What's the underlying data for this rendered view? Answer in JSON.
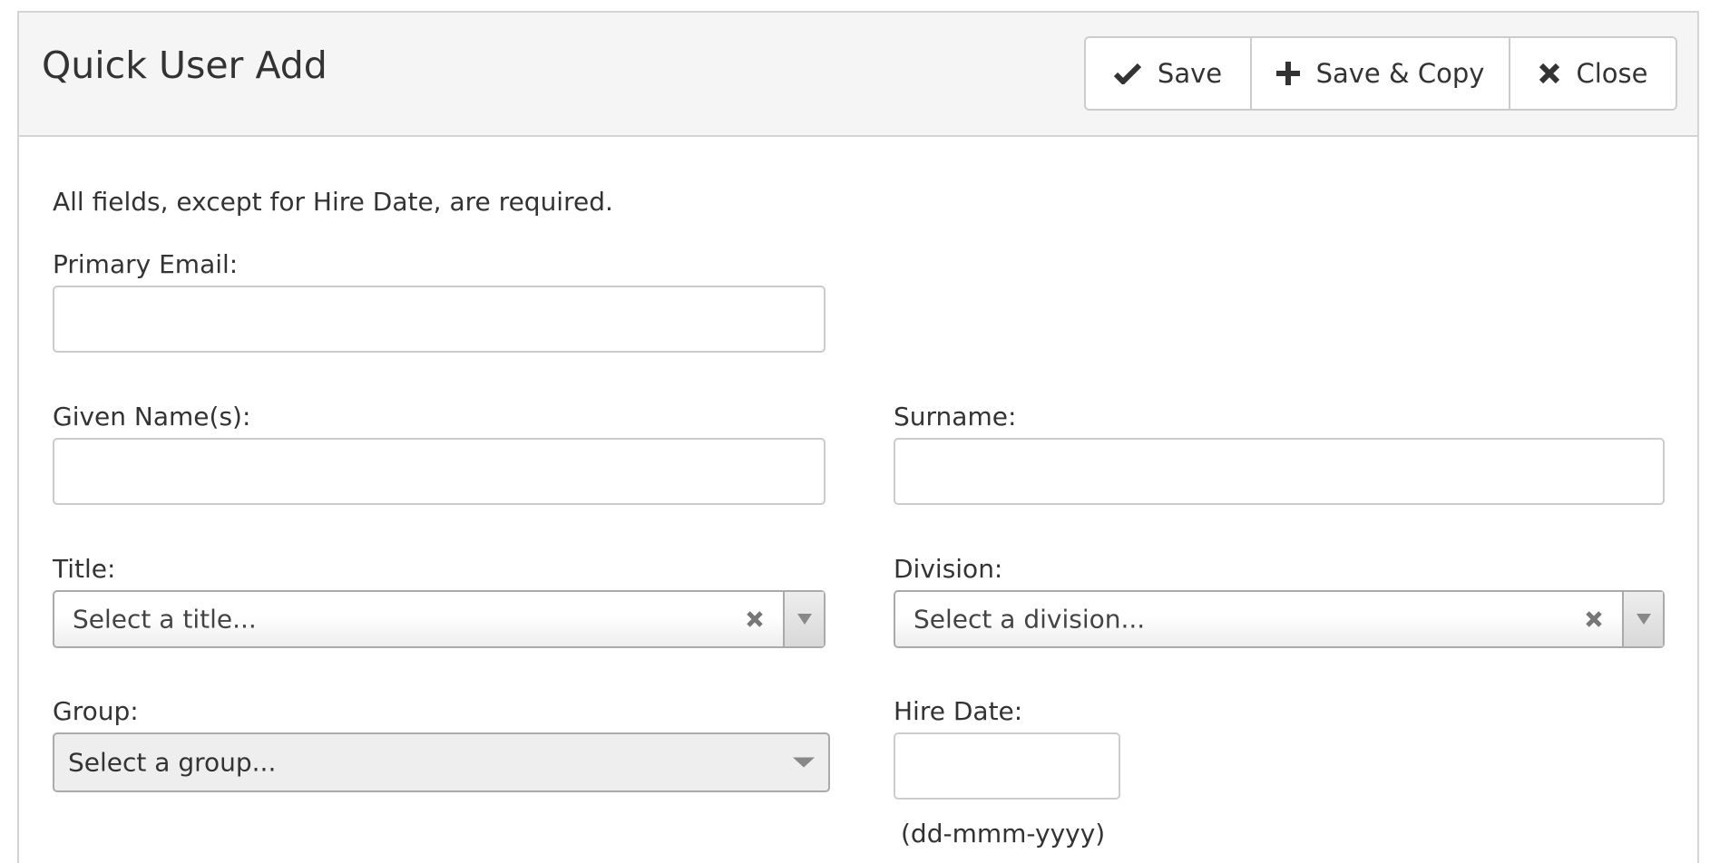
{
  "dialog": {
    "title": "Quick User Add"
  },
  "toolbar": {
    "save_label": "Save",
    "save_copy_label": "Save & Copy",
    "close_label": "Close"
  },
  "form": {
    "instructions": "All fields, except for Hire Date, are required.",
    "primary_email": {
      "label": "Primary Email:",
      "value": ""
    },
    "given_names": {
      "label": "Given Name(s):",
      "value": ""
    },
    "surname": {
      "label": "Surname:",
      "value": ""
    },
    "title": {
      "label": "Title:",
      "placeholder": "Select a title..."
    },
    "division": {
      "label": "Division:",
      "placeholder": "Select a division..."
    },
    "group": {
      "label": "Group:",
      "placeholder": "Select a group..."
    },
    "hire_date": {
      "label": "Hire Date:",
      "value": "",
      "format_hint": "(dd-mmm-yyyy)"
    }
  },
  "icons": {
    "save": "check-icon",
    "save_copy": "plus-icon",
    "close": "close-icon",
    "clear": "clear-x-icon",
    "dropdown": "caret-down-icon"
  },
  "colors": {
    "header_bg": "#f5f5f5",
    "border": "#cccccc",
    "text": "#333333"
  }
}
